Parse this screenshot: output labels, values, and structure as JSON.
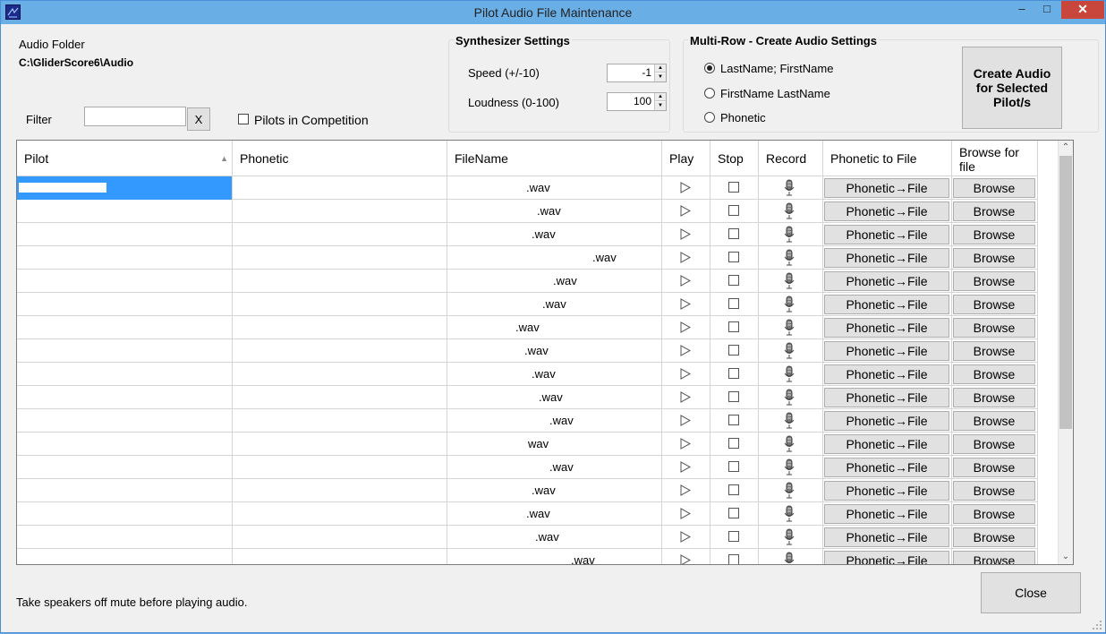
{
  "window": {
    "title": "Pilot Audio File Maintenance",
    "minimize": "‒",
    "maximize": "□",
    "close": "✕"
  },
  "audio_folder": {
    "label": "Audio Folder",
    "path": "C:\\GliderScore6\\Audio"
  },
  "filter": {
    "label": "Filter",
    "value": "",
    "clear_label": "X",
    "pilots_in_competition_label": "Pilots in Competition",
    "pilots_in_competition_checked": false
  },
  "synth": {
    "title": "Synthesizer Settings",
    "speed_label": "Speed (+/-10)",
    "speed_value": "-1",
    "loudness_label": "Loudness (0-100)",
    "loudness_value": "100"
  },
  "multirow": {
    "title": "Multi-Row - Create Audio Settings",
    "options": [
      "LastName; FirstName",
      "FirstName LastName",
      "Phonetic"
    ],
    "selected": 0
  },
  "create_button": "Create Audio for Selected Pilot/s",
  "grid": {
    "columns": {
      "pilot": "Pilot",
      "phonetic": "Phonetic",
      "filename": "FileName",
      "play": "Play",
      "stop": "Stop",
      "record": "Record",
      "phonetic_to_file": "Phonetic to File",
      "browse": "Browse for file"
    },
    "phonetic_button_label": "Phonetic→File",
    "browse_button_label": "Browse",
    "rows": [
      {
        "filename": ".wav"
      },
      {
        "filename": ".wav"
      },
      {
        "filename": ".wav"
      },
      {
        "filename": ".wav"
      },
      {
        "filename": ".wav"
      },
      {
        "filename": ".wav"
      },
      {
        "filename": ".wav"
      },
      {
        "filename": ".wav"
      },
      {
        "filename": ".wav"
      },
      {
        "filename": ".wav"
      },
      {
        "filename": ".wav"
      },
      {
        "filename": "wav"
      },
      {
        "filename": ".wav"
      },
      {
        "filename": ".wav"
      },
      {
        "filename": ".wav"
      },
      {
        "filename": ".wav"
      },
      {
        "filename": ".wav"
      }
    ]
  },
  "footer": {
    "note": "Take speakers off mute before playing audio.",
    "close_label": "Close"
  }
}
